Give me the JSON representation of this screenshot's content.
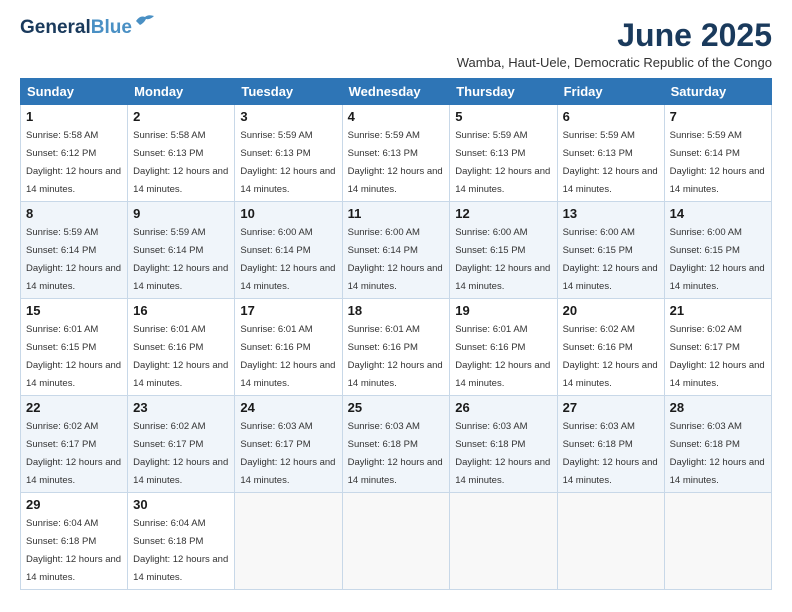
{
  "logo": {
    "line1": "General",
    "line2": "Blue"
  },
  "title": "June 2025",
  "subtitle": "Wamba, Haut-Uele, Democratic Republic of the Congo",
  "days_of_week": [
    "Sunday",
    "Monday",
    "Tuesday",
    "Wednesday",
    "Thursday",
    "Friday",
    "Saturday"
  ],
  "weeks": [
    [
      {
        "day": "1",
        "sunrise": "Sunrise: 5:58 AM",
        "sunset": "Sunset: 6:12 PM",
        "daylight": "Daylight: 12 hours and 14 minutes."
      },
      {
        "day": "2",
        "sunrise": "Sunrise: 5:58 AM",
        "sunset": "Sunset: 6:13 PM",
        "daylight": "Daylight: 12 hours and 14 minutes."
      },
      {
        "day": "3",
        "sunrise": "Sunrise: 5:59 AM",
        "sunset": "Sunset: 6:13 PM",
        "daylight": "Daylight: 12 hours and 14 minutes."
      },
      {
        "day": "4",
        "sunrise": "Sunrise: 5:59 AM",
        "sunset": "Sunset: 6:13 PM",
        "daylight": "Daylight: 12 hours and 14 minutes."
      },
      {
        "day": "5",
        "sunrise": "Sunrise: 5:59 AM",
        "sunset": "Sunset: 6:13 PM",
        "daylight": "Daylight: 12 hours and 14 minutes."
      },
      {
        "day": "6",
        "sunrise": "Sunrise: 5:59 AM",
        "sunset": "Sunset: 6:13 PM",
        "daylight": "Daylight: 12 hours and 14 minutes."
      },
      {
        "day": "7",
        "sunrise": "Sunrise: 5:59 AM",
        "sunset": "Sunset: 6:14 PM",
        "daylight": "Daylight: 12 hours and 14 minutes."
      }
    ],
    [
      {
        "day": "8",
        "sunrise": "Sunrise: 5:59 AM",
        "sunset": "Sunset: 6:14 PM",
        "daylight": "Daylight: 12 hours and 14 minutes."
      },
      {
        "day": "9",
        "sunrise": "Sunrise: 5:59 AM",
        "sunset": "Sunset: 6:14 PM",
        "daylight": "Daylight: 12 hours and 14 minutes."
      },
      {
        "day": "10",
        "sunrise": "Sunrise: 6:00 AM",
        "sunset": "Sunset: 6:14 PM",
        "daylight": "Daylight: 12 hours and 14 minutes."
      },
      {
        "day": "11",
        "sunrise": "Sunrise: 6:00 AM",
        "sunset": "Sunset: 6:14 PM",
        "daylight": "Daylight: 12 hours and 14 minutes."
      },
      {
        "day": "12",
        "sunrise": "Sunrise: 6:00 AM",
        "sunset": "Sunset: 6:15 PM",
        "daylight": "Daylight: 12 hours and 14 minutes."
      },
      {
        "day": "13",
        "sunrise": "Sunrise: 6:00 AM",
        "sunset": "Sunset: 6:15 PM",
        "daylight": "Daylight: 12 hours and 14 minutes."
      },
      {
        "day": "14",
        "sunrise": "Sunrise: 6:00 AM",
        "sunset": "Sunset: 6:15 PM",
        "daylight": "Daylight: 12 hours and 14 minutes."
      }
    ],
    [
      {
        "day": "15",
        "sunrise": "Sunrise: 6:01 AM",
        "sunset": "Sunset: 6:15 PM",
        "daylight": "Daylight: 12 hours and 14 minutes."
      },
      {
        "day": "16",
        "sunrise": "Sunrise: 6:01 AM",
        "sunset": "Sunset: 6:16 PM",
        "daylight": "Daylight: 12 hours and 14 minutes."
      },
      {
        "day": "17",
        "sunrise": "Sunrise: 6:01 AM",
        "sunset": "Sunset: 6:16 PM",
        "daylight": "Daylight: 12 hours and 14 minutes."
      },
      {
        "day": "18",
        "sunrise": "Sunrise: 6:01 AM",
        "sunset": "Sunset: 6:16 PM",
        "daylight": "Daylight: 12 hours and 14 minutes."
      },
      {
        "day": "19",
        "sunrise": "Sunrise: 6:01 AM",
        "sunset": "Sunset: 6:16 PM",
        "daylight": "Daylight: 12 hours and 14 minutes."
      },
      {
        "day": "20",
        "sunrise": "Sunrise: 6:02 AM",
        "sunset": "Sunset: 6:16 PM",
        "daylight": "Daylight: 12 hours and 14 minutes."
      },
      {
        "day": "21",
        "sunrise": "Sunrise: 6:02 AM",
        "sunset": "Sunset: 6:17 PM",
        "daylight": "Daylight: 12 hours and 14 minutes."
      }
    ],
    [
      {
        "day": "22",
        "sunrise": "Sunrise: 6:02 AM",
        "sunset": "Sunset: 6:17 PM",
        "daylight": "Daylight: 12 hours and 14 minutes."
      },
      {
        "day": "23",
        "sunrise": "Sunrise: 6:02 AM",
        "sunset": "Sunset: 6:17 PM",
        "daylight": "Daylight: 12 hours and 14 minutes."
      },
      {
        "day": "24",
        "sunrise": "Sunrise: 6:03 AM",
        "sunset": "Sunset: 6:17 PM",
        "daylight": "Daylight: 12 hours and 14 minutes."
      },
      {
        "day": "25",
        "sunrise": "Sunrise: 6:03 AM",
        "sunset": "Sunset: 6:18 PM",
        "daylight": "Daylight: 12 hours and 14 minutes."
      },
      {
        "day": "26",
        "sunrise": "Sunrise: 6:03 AM",
        "sunset": "Sunset: 6:18 PM",
        "daylight": "Daylight: 12 hours and 14 minutes."
      },
      {
        "day": "27",
        "sunrise": "Sunrise: 6:03 AM",
        "sunset": "Sunset: 6:18 PM",
        "daylight": "Daylight: 12 hours and 14 minutes."
      },
      {
        "day": "28",
        "sunrise": "Sunrise: 6:03 AM",
        "sunset": "Sunset: 6:18 PM",
        "daylight": "Daylight: 12 hours and 14 minutes."
      }
    ],
    [
      {
        "day": "29",
        "sunrise": "Sunrise: 6:04 AM",
        "sunset": "Sunset: 6:18 PM",
        "daylight": "Daylight: 12 hours and 14 minutes."
      },
      {
        "day": "30",
        "sunrise": "Sunrise: 6:04 AM",
        "sunset": "Sunset: 6:18 PM",
        "daylight": "Daylight: 12 hours and 14 minutes."
      },
      {
        "day": "",
        "sunrise": "",
        "sunset": "",
        "daylight": ""
      },
      {
        "day": "",
        "sunrise": "",
        "sunset": "",
        "daylight": ""
      },
      {
        "day": "",
        "sunrise": "",
        "sunset": "",
        "daylight": ""
      },
      {
        "day": "",
        "sunrise": "",
        "sunset": "",
        "daylight": ""
      },
      {
        "day": "",
        "sunrise": "",
        "sunset": "",
        "daylight": ""
      }
    ]
  ]
}
